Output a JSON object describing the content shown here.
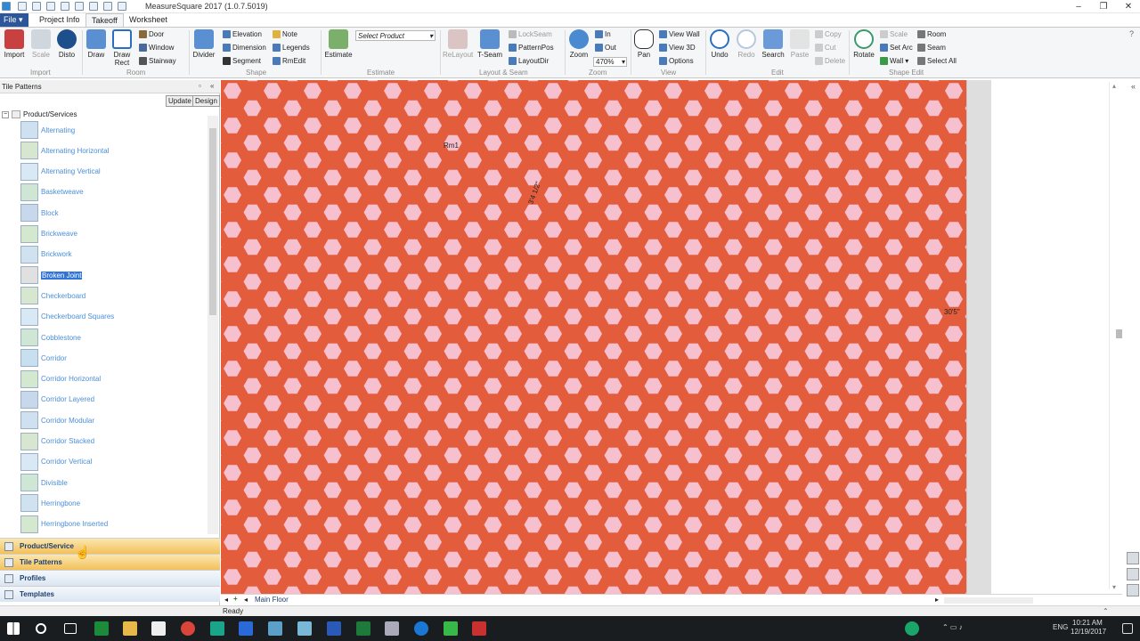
{
  "app": {
    "title": "MeasureSquare 2017 (1.0.7.5019)"
  },
  "menu": {
    "file": "File",
    "tabs": [
      "Project Info",
      "Takeoff",
      "Worksheet"
    ]
  },
  "ribbon": {
    "import": "Import",
    "scale": "Scale",
    "disto": "Disto",
    "draw": "Draw",
    "draw_rect": "Draw Rect",
    "door": "Door",
    "window": "Window",
    "stairway": "Stairway",
    "divider": "Divider",
    "elevation": "Elevation",
    "dimension": "Dimension",
    "segment": "Segment",
    "note": "Note",
    "legends": "Legends",
    "rmedit": "RmEdit",
    "estimate": "Estimate",
    "select_product": "Select Product",
    "relayout": "ReLayout",
    "t_seam": "T-Seam",
    "lockseam": "LockSeam",
    "patternpos": "PatternPos",
    "layoutdir": "LayoutDir",
    "zoom": "Zoom",
    "zoom_in": "In",
    "zoom_out": "Out",
    "zoom_value": "470%",
    "pan": "Pan",
    "view_wall": "View Wall",
    "view_3d": "View 3D",
    "options": "Options",
    "undo": "Undo",
    "redo": "Redo",
    "search": "Search",
    "paste": "Paste",
    "copy": "Copy",
    "cut": "Cut",
    "delete": "Delete",
    "rotate": "Rotate",
    "scale2": "Scale",
    "set_arc": "Set Arc",
    "wall": "Wall",
    "room": "Room",
    "seam": "Seam",
    "select_all": "Select All",
    "groups": {
      "import": "Import",
      "room": "Room",
      "shape": "Shape",
      "estimate": "Estimate",
      "layout_seam": "Layout & Seam",
      "zoom": "Zoom",
      "view": "View",
      "edit": "Edit",
      "shape_edit": "Shape Edit"
    }
  },
  "left_panel": {
    "title": "Tile Patterns",
    "update": "Update",
    "design": "Design",
    "root": "Product/Services",
    "items": [
      "Alternating",
      "Alternating Horizontal",
      "Alternating Vertical",
      "Basketweave",
      "Block",
      "Brickweave",
      "Brickwork",
      "Broken Joint",
      "Checkerboard",
      "Checkerboard Squares",
      "Cobblestone",
      "Corridor",
      "Corridor Horizontal",
      "Corridor Layered",
      "Corridor Modular",
      "Corridor Stacked",
      "Corridor Vertical",
      "Divisible",
      "Herringbone",
      "Herringbone Inserted"
    ],
    "selected": "Broken Joint",
    "bottom_tabs": [
      "Product/Service",
      "Tile Patterns",
      "Profiles",
      "Templates"
    ]
  },
  "canvas": {
    "room_label": "Rm1",
    "dim_right": "30'5\"",
    "dim_diag": "3'4 1/2\"",
    "tile_color": "#f7c0cf",
    "grout_color": "#e35d3d"
  },
  "sheet": {
    "tab": "Main Floor"
  },
  "status": {
    "text": "Ready"
  },
  "tray": {
    "lang": "ENG",
    "time": "10:21 AM",
    "date": "12/19/2017"
  }
}
